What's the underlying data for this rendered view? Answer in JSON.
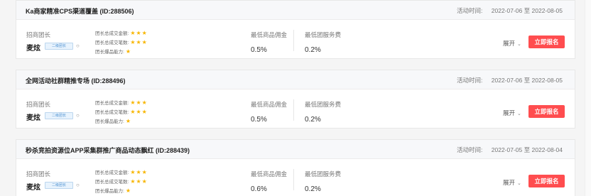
{
  "labels": {
    "time_label": "活动时间:",
    "time_sep": "至",
    "leader_label": "招商团长",
    "stat_amount": "团长总成交金额:",
    "stat_count": "团长总成交笔数:",
    "stat_ability": "团长爆品能力:",
    "min_commission": "最低商品佣金",
    "min_fee": "最低团服务费",
    "expand": "展开",
    "signup": "立即报名",
    "cert_badge": "二级团长"
  },
  "colors": {
    "accent": "#ff4d4f",
    "star": "#f7b500"
  },
  "cards": [
    {
      "title": "Ka商家精准CPS渠道覆盖 (ID:288506)",
      "start": "2022-07-06",
      "end": "2022-08-05",
      "leader": "麦炫",
      "amount_stars": "★★★",
      "count_stars": "★★★",
      "ability_stars": "★",
      "commission": "0.5%",
      "fee": "0.2%"
    },
    {
      "title": "全网活动社群精推专场 (ID:288496)",
      "start": "2022-07-06",
      "end": "2022-08-05",
      "leader": "麦炫",
      "amount_stars": "★★★",
      "count_stars": "★★★",
      "ability_stars": "★",
      "commission": "0.5%",
      "fee": "0.2%"
    },
    {
      "title": "秒杀竞拍资源位APP采集群推广商品动态飘红 (ID:288439)",
      "start": "2022-07-05",
      "end": "2022-08-04",
      "leader": "麦炫",
      "amount_stars": "★★★",
      "count_stars": "★★★",
      "ability_stars": "★",
      "commission": "0.6%",
      "fee": "0.2%"
    }
  ]
}
